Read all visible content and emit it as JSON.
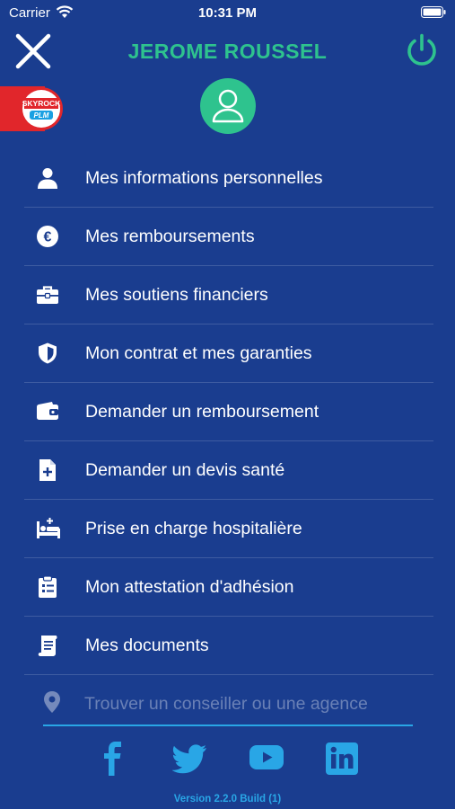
{
  "status_bar": {
    "carrier": "Carrier",
    "time": "10:31 PM"
  },
  "header": {
    "user_name": "JEROME ROUSSEL"
  },
  "badge": {
    "line1": "SKYROCK",
    "line2": "PLM"
  },
  "menu": [
    {
      "label": "Mes informations personnelles",
      "icon": "user-icon"
    },
    {
      "label": "Mes remboursements",
      "icon": "euro-icon"
    },
    {
      "label": "Mes soutiens financiers",
      "icon": "briefcase-icon"
    },
    {
      "label": "Mon contrat et mes garanties",
      "icon": "shield-icon"
    },
    {
      "label": "Demander un remboursement",
      "icon": "wallet-icon"
    },
    {
      "label": "Demander un devis santé",
      "icon": "document-plus-icon"
    },
    {
      "label": "Prise en charge hospitalière",
      "icon": "hospital-bed-icon"
    },
    {
      "label": "Mon attestation d'adhésion",
      "icon": "clipboard-icon"
    },
    {
      "label": "Mes documents",
      "icon": "scroll-icon"
    }
  ],
  "search": {
    "placeholder": "Trouver un conseiller ou une agence",
    "value": "",
    "icon": "location-pin-icon"
  },
  "socials": [
    "facebook-icon",
    "twitter-icon",
    "youtube-icon",
    "linkedin-icon"
  ],
  "footer": {
    "version": "Version 2.2.0 Build (1)"
  },
  "colors": {
    "background": "#1a3d8f",
    "accent_green": "#2ec38e",
    "accent_blue": "#29a6e6"
  }
}
